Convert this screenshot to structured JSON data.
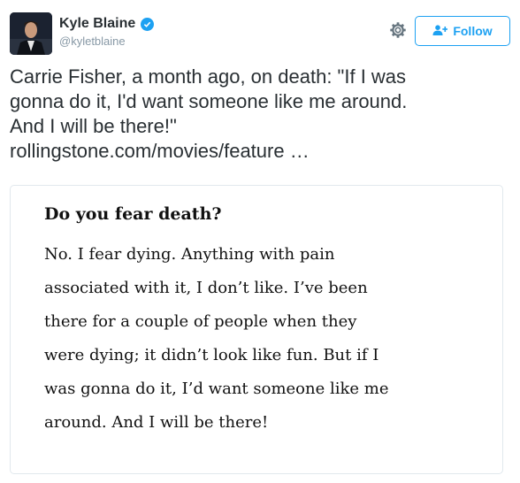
{
  "tweet": {
    "author": {
      "display_name": "Kyle Blaine",
      "handle": "@kyletblaine",
      "verified": true
    },
    "follow_label": "Follow",
    "text_lines": [
      "Carrie Fisher, a month ago, on death: \"If I was",
      "gonna do it, I'd want someone like me around.",
      "And I will be there!\"",
      "rollingstone.com/movies/feature …"
    ],
    "card": {
      "question": "Do you fear death?",
      "answer_lines": [
        "No. I fear dying. Anything with pain",
        "associated with it, I don’t like. I’ve been",
        "there for a couple of people when they",
        "were dying; it didn’t look like fun. But if I",
        "was gonna do it, I’d want someone like me",
        "around. And I will be there!"
      ]
    }
  },
  "colors": {
    "accent": "#1da1f2",
    "text": "#292f33",
    "muted": "#8899a6",
    "border": "#e1e8ed"
  },
  "icons": {
    "verified": "verified-badge-icon",
    "settings": "gear-icon",
    "follow": "add-user-icon"
  }
}
